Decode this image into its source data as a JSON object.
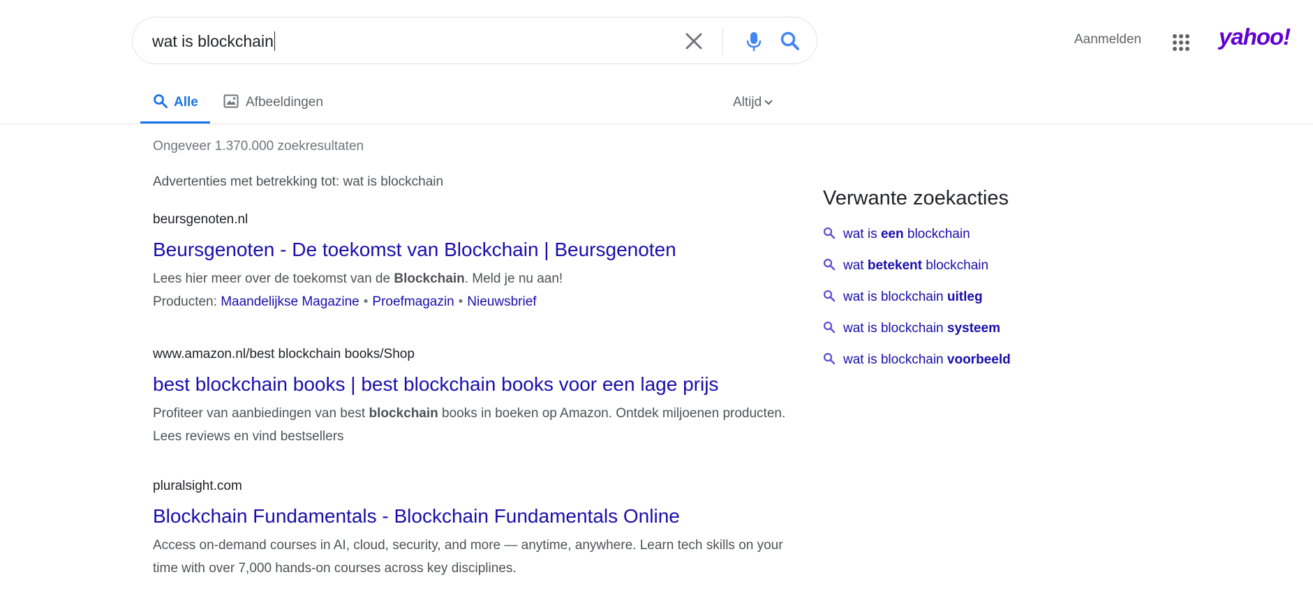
{
  "search": {
    "query": "wat is blockchain"
  },
  "header": {
    "signin_label": "Aanmelden",
    "logo_text": "yahoo!",
    "logo_color": "#6001d2"
  },
  "tabs": {
    "all_label": "Alle",
    "images_label": "Afbeeldingen",
    "time_filter": "Altijd"
  },
  "results_count": "Ongeveer 1.370.000 zoekresultaten",
  "ads_label": "Advertenties met betrekking tot: wat is blockchain",
  "results": [
    {
      "url": "beursgenoten.nl",
      "title": "Beursgenoten - De toekomst van Blockchain | Beursgenoten",
      "desc_pre": "Lees hier meer over de toekomst van de ",
      "desc_bold": "Blockchain",
      "desc_post": ". Meld je nu aan!",
      "sitelinks_label": "Producten:",
      "sitelinks": [
        "Maandelijkse Magazine",
        "Proefmagazin",
        "Nieuwsbrief"
      ]
    },
    {
      "url": "www.amazon.nl/best blockchain books/Shop",
      "title": "best blockchain books | best blockchain books voor een lage prijs",
      "desc_pre": "Profiteer van aanbiedingen van best ",
      "desc_bold": "blockchain",
      "desc_post": " books in boeken op Amazon. Ontdek miljoenen producten. Lees reviews en vind bestsellers"
    },
    {
      "url": "pluralsight.com",
      "title": "Blockchain Fundamentals - Blockchain Fundamentals Online",
      "desc": "Access on-demand courses in AI, cloud, security, and more — anytime, anywhere. Learn tech skills on your time with over 7,000 hands-on courses across key disciplines."
    }
  ],
  "related": {
    "title": "Verwante zoekacties",
    "items": [
      {
        "pre": "wat is ",
        "bold": "een",
        "post": " blockchain"
      },
      {
        "pre": "wat ",
        "bold": "betekent",
        "post": " blockchain"
      },
      {
        "pre": "wat is blockchain ",
        "bold": "uitleg",
        "post": ""
      },
      {
        "pre": "wat is blockchain ",
        "bold": "systeem",
        "post": ""
      },
      {
        "pre": "wat is blockchain ",
        "bold": "voorbeeld",
        "post": ""
      }
    ]
  },
  "colors": {
    "accent": "#1a73e8",
    "link": "#1a0dab",
    "related_icon": "#5a4fcf"
  },
  "icons": [
    "clear-icon",
    "mic-icon",
    "search-icon",
    "apps-grid-icon",
    "image-icon",
    "chevron-down-icon"
  ]
}
